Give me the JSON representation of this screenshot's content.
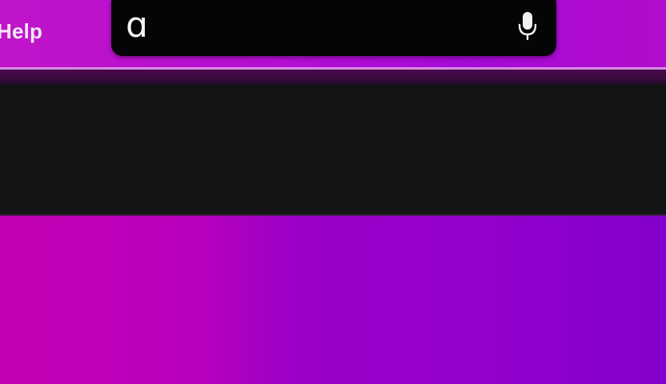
{
  "menu_bar": {
    "help_label": "Help"
  },
  "spotlight": {
    "query_glyph": "ɑ",
    "mic_icon": "microphone-icon"
  },
  "colors": {
    "wallpaper_left": "#c400b4",
    "wallpaper_right": "#8400cc",
    "spotlight_bg": "#050406",
    "panel_bg": "#131415"
  }
}
